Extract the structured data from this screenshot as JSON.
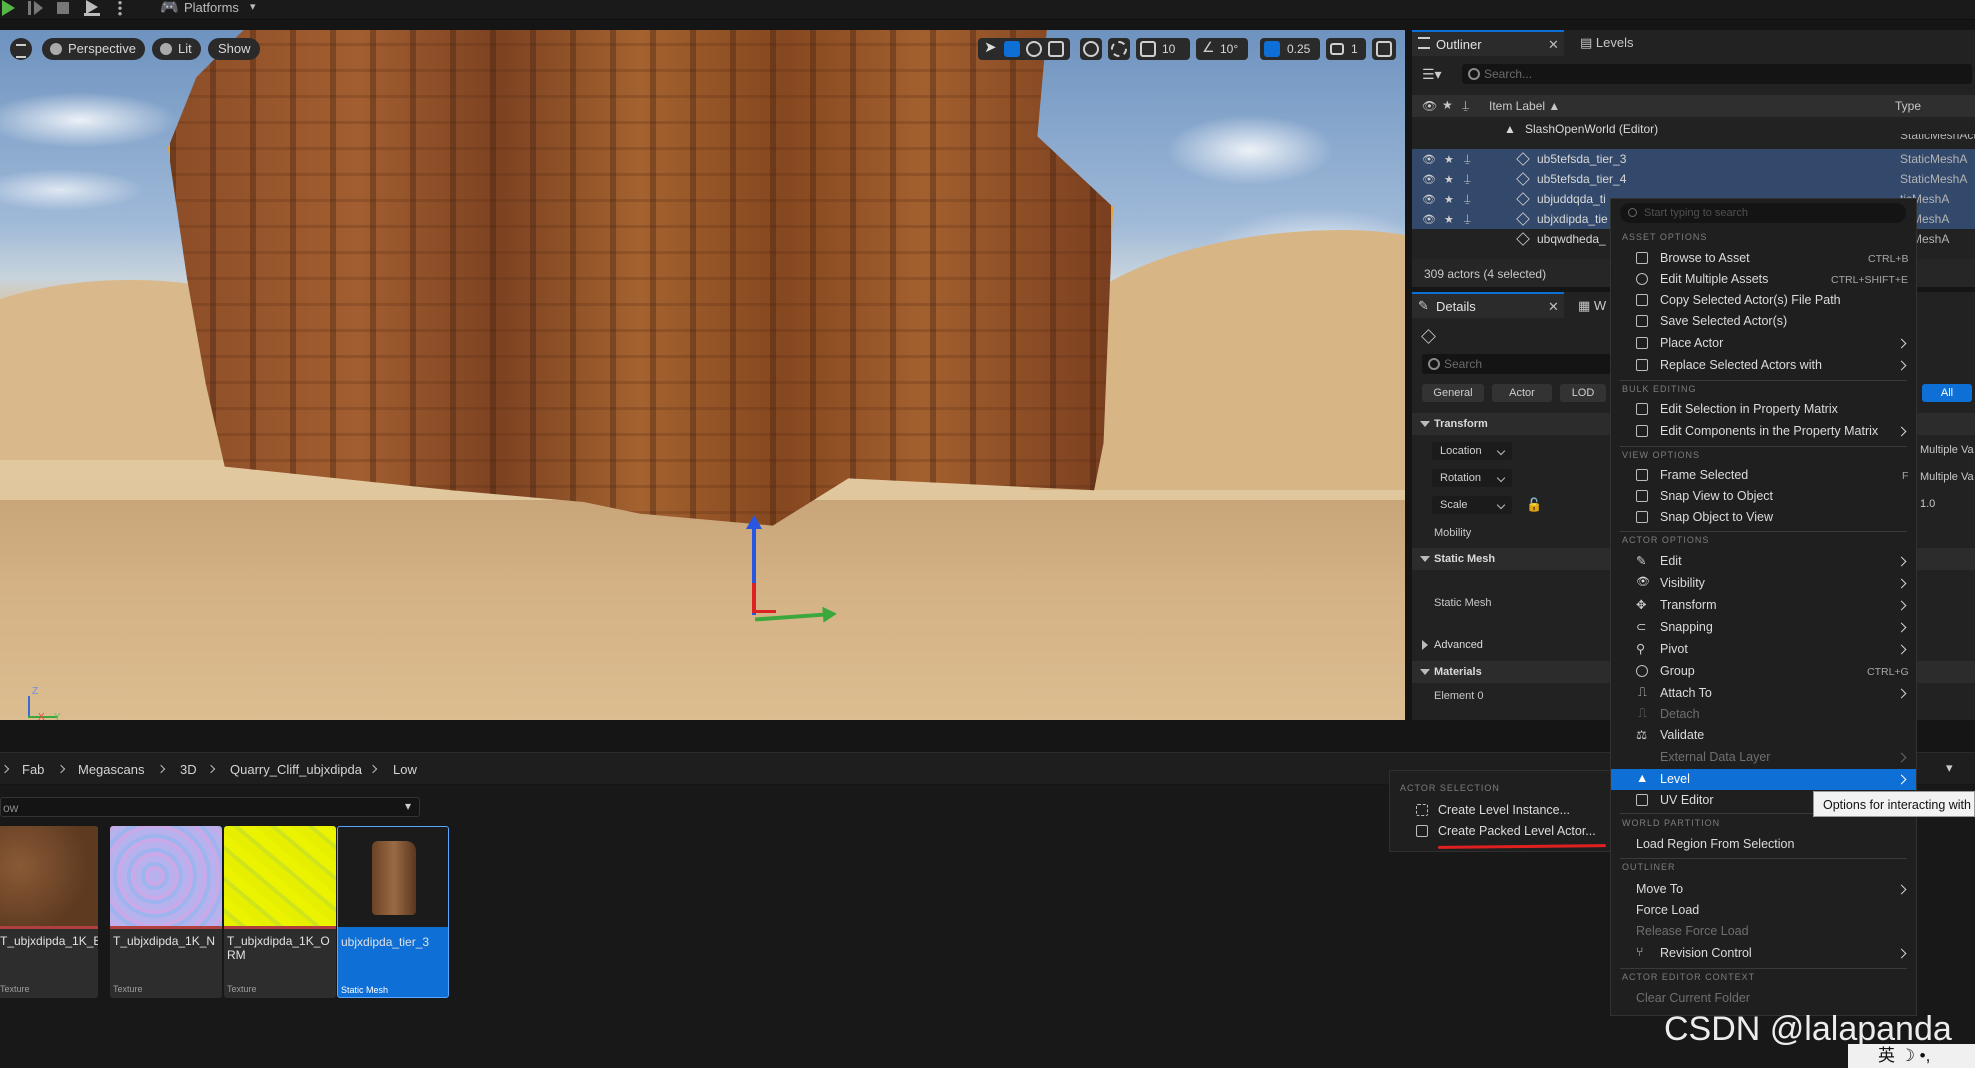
{
  "toolbar": {
    "platforms_label": "Platforms"
  },
  "viewport": {
    "perspective_label": "Perspective",
    "lit_label": "Lit",
    "show_label": "Show",
    "grid_snap": "10",
    "rotation_snap": "10°",
    "scale_snap": "0.25",
    "camera_speed": "1",
    "axis_z": "Z",
    "axis_x": "X",
    "axis_y": "Y"
  },
  "outliner": {
    "tab_label": "Outliner",
    "levels_tab": "Levels",
    "search_placeholder": "Search...",
    "col_item_label": "Item Label",
    "col_type": "Type",
    "world_row": "SlashOpenWorld (Editor)",
    "cut_row_type": "StaticMeshActor",
    "rows": [
      {
        "label": "ub5tefsda_tier_3",
        "type": "StaticMeshA"
      },
      {
        "label": "ub5tefsda_tier_4",
        "type": "StaticMeshA"
      },
      {
        "label": "ubjuddqda_ti",
        "type": "ticMeshA"
      },
      {
        "label": "ubjxdipda_tie",
        "type": "ticMeshA"
      },
      {
        "label": "ubqwdheda_",
        "type": "ticMeshA"
      }
    ],
    "status": "309 actors (4 selected)"
  },
  "details": {
    "tab_label": "Details",
    "second_tab": "W",
    "search_placeholder": "Search",
    "filters": [
      "General",
      "Actor",
      "LOD",
      "All"
    ],
    "transform_section": "Transform",
    "location_label": "Location",
    "rotation_label": "Rotation",
    "scale_label": "Scale",
    "mobility_label": "Mobility",
    "location_value": "Multiple Va",
    "rotation_value": "Multiple Va",
    "scale_value": "1.0",
    "static_mesh_section": "Static Mesh",
    "static_mesh_label": "Static Mesh",
    "advanced_section": "Advanced",
    "materials_section": "Materials",
    "element0_label": "Element 0"
  },
  "content_browser": {
    "breadcrumbs": [
      "Fab",
      "Megascans",
      "3D",
      "Quarry_Cliff_ubjxdipda",
      "Low"
    ],
    "filter_value": "ow",
    "assets": [
      {
        "name": "T_ubjxdipda_1K_B",
        "kind": "Texture",
        "thumb_color": "#7a4a2a"
      },
      {
        "name": "T_ubjxdipda_1K_N",
        "kind": "Texture",
        "thumb_color": "#a9a4e6"
      },
      {
        "name": "T_ubjxdipda_1K_ORM",
        "kind": "Texture",
        "thumb_color": "#e8f000"
      },
      {
        "name": "ubjxdipda_tier_3",
        "kind": "Static Mesh",
        "thumb_color": "#1b1b1b"
      }
    ]
  },
  "actor_selection_menu": {
    "section": "ACTOR SELECTION",
    "items": [
      "Create Level Instance...",
      "Create Packed Level Actor..."
    ]
  },
  "context_menu": {
    "search_placeholder": "Start typing to search",
    "sections": {
      "asset_options": "ASSET OPTIONS",
      "bulk_editing": "BULK EDITING",
      "view_options": "VIEW OPTIONS",
      "actor_options": "ACTOR OPTIONS",
      "world_partition": "WORLD PARTITION",
      "outliner": "OUTLINER",
      "actor_editor_context": "ACTOR EDITOR CONTEXT"
    },
    "items": {
      "browse_to_asset": "Browse to Asset",
      "browse_shortcut": "CTRL+B",
      "edit_multiple_assets": "Edit Multiple Assets",
      "edit_multiple_shortcut": "CTRL+SHIFT+E",
      "copy_file_path": "Copy Selected Actor(s) File Path",
      "save_selected": "Save Selected Actor(s)",
      "place_actor": "Place Actor",
      "replace_actors": "Replace Selected Actors with",
      "edit_selection_matrix": "Edit Selection in Property Matrix",
      "edit_components_matrix": "Edit Components in the Property Matrix",
      "frame_selected": "Frame Selected",
      "frame_shortcut": "F",
      "snap_view_to_object": "Snap View to Object",
      "snap_object_to_view": "Snap Object to View",
      "edit": "Edit",
      "visibility": "Visibility",
      "transform": "Transform",
      "snapping": "Snapping",
      "pivot": "Pivot",
      "group": "Group",
      "group_shortcut": "CTRL+G",
      "attach_to": "Attach To",
      "detach": "Detach",
      "validate": "Validate",
      "external_data_layer": "External Data Layer",
      "level": "Level",
      "uv_editor": "UV Editor",
      "load_region": "Load Region From Selection",
      "move_to": "Move To",
      "force_load": "Force Load",
      "release_force_load": "Release Force Load",
      "revision_control": "Revision Control",
      "clear_current_folder": "Clear Current Folder"
    },
    "tooltip": "Options for interacting with"
  },
  "watermark": "CSDN @lalapanda",
  "ime": "英 ☽ •,"
}
